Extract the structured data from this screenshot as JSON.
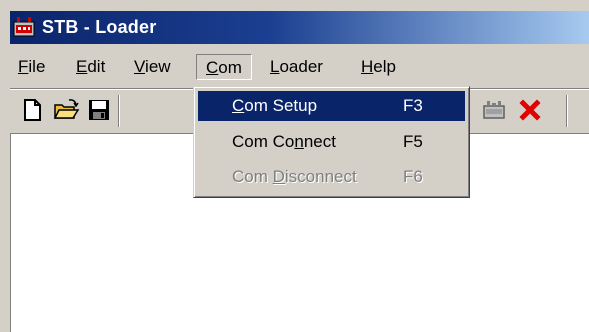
{
  "window": {
    "title": "STB - Loader",
    "icon": "stb-loader-app-icon"
  },
  "menubar": {
    "items": [
      {
        "label": "File",
        "mnemonic": "F"
      },
      {
        "label": "Edit",
        "mnemonic": "E"
      },
      {
        "label": "View",
        "mnemonic": "V"
      },
      {
        "label": "Com",
        "mnemonic": "C",
        "open": true
      },
      {
        "label": "Loader",
        "mnemonic": "L"
      },
      {
        "label": "Help",
        "mnemonic": "H"
      }
    ]
  },
  "toolbar": {
    "buttons": [
      {
        "icon": "new-document-icon"
      },
      {
        "icon": "open-folder-icon"
      },
      {
        "icon": "save-disk-icon"
      },
      {
        "icon": "connect-icon",
        "disabled": true
      },
      {
        "icon": "loader-device-icon"
      },
      {
        "icon": "close-x-icon"
      }
    ]
  },
  "com_menu": {
    "items": [
      {
        "label_pre": "",
        "label_u": "C",
        "label_post": "om Setup",
        "shortcut": "F3",
        "state": "selected"
      },
      {
        "label_pre": "Com Co",
        "label_u": "n",
        "label_post": "nect",
        "shortcut": "F5",
        "state": "enabled"
      },
      {
        "label_pre": "Com ",
        "label_u": "D",
        "label_post": "isconnect",
        "shortcut": "F6",
        "state": "disabled"
      }
    ]
  },
  "colors": {
    "titlebar_start": "#0a246a",
    "titlebar_end": "#a6caf0",
    "face": "#d4d0c8",
    "highlight": "#0a246a",
    "delete_red": "#e00000"
  }
}
